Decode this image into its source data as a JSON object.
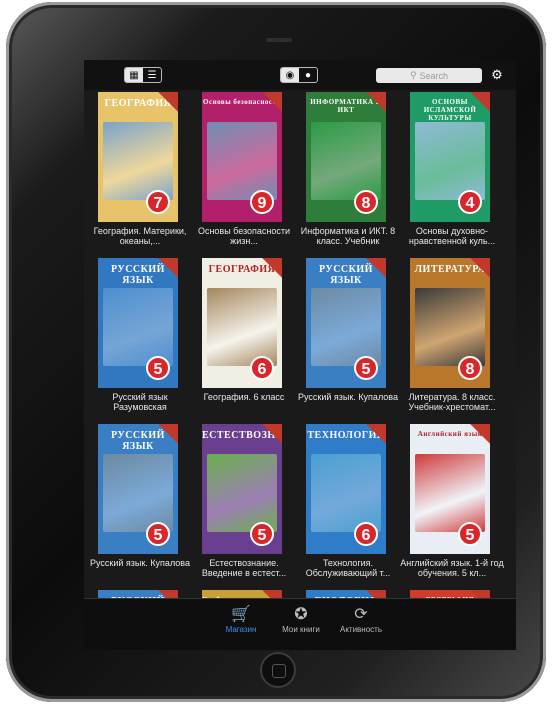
{
  "toolbar": {
    "view_grid_icon": "grid-icon",
    "view_list_icon": "list-icon",
    "globe_icon": "globe-icon",
    "person_icon": "person-icon",
    "search_placeholder": "Search",
    "settings_icon": "gear-icon"
  },
  "books": [
    {
      "cover_title": "ГЕОГРАФИЯ",
      "title": "География. Материки, океаны,...",
      "num": "7",
      "color": "#e7c46a",
      "art": "#7aa3c9"
    },
    {
      "cover_title": "Основы безопасности",
      "title": "Основы безопасности жизн...",
      "num": "9",
      "color": "#b21f6a",
      "art": "#6f8fb5"
    },
    {
      "cover_title": "ИНФОРМАТИКА И ИКТ",
      "title": "Информатика и ИКТ. 8 класс. Учебник",
      "num": "8",
      "color": "#2f7d3a",
      "art": "#2b9c45"
    },
    {
      "cover_title": "ОСНОВЫ ИСЛАМСКОЙ КУЛЬТУРЫ",
      "title": "Основы духовно-нравственной куль...",
      "num": "4",
      "color": "#1f9b66",
      "art": "#8fb9d8"
    },
    {
      "cover_title": "РУССКИЙ ЯЗЫК",
      "title": "Русский язык Разумовская",
      "num": "5",
      "color": "#3178c1",
      "art": "#4e8fcf"
    },
    {
      "cover_title": "ГЕОГРАФИЯ",
      "title": "География. 6 класс",
      "num": "6",
      "color": "#f1eee4",
      "art": "#a3865c"
    },
    {
      "cover_title": "РУССКИЙ ЯЗЫК",
      "title": "Русский язык. Купалова",
      "num": "5",
      "color": "#3a7fc4",
      "art": "#6c8aa3"
    },
    {
      "cover_title": "ЛИТЕРАТУРА",
      "title": "Литература. 8 класс. Учебник-хрестомат...",
      "num": "8",
      "color": "#b8772a",
      "art": "#3a3a3a"
    },
    {
      "cover_title": "РУССКИЙ ЯЗЫК",
      "title": "Русский язык. Купалова",
      "num": "5",
      "color": "#3a7fc4",
      "art": "#6c8aa3"
    },
    {
      "cover_title": "ЕСТЕСТВОЗНАНИЕ",
      "title": "Естествознание. Введение в естест...",
      "num": "5",
      "color": "#6b3f8f",
      "art": "#6ab04c"
    },
    {
      "cover_title": "ТЕХНОЛОГИЯ",
      "title": "Технология. Обслуживающий т...",
      "num": "6",
      "color": "#2f7dc9",
      "art": "#4aa0d0"
    },
    {
      "cover_title": "Английский язык",
      "title": "Английский язык. 1-й год обучения. 5 кл...",
      "num": "5",
      "color": "#e9eef5",
      "art": "#cf3a3a"
    },
    {
      "cover_title": "РУССКИЙ ЯЗЫК",
      "title": "",
      "num": "",
      "color": "#3a7fc4",
      "art": "#6c8aa3"
    },
    {
      "cover_title": "Учебник-хрестоматия",
      "title": "",
      "num": "",
      "color": "#c8a03a",
      "art": "#7a3a2a"
    },
    {
      "cover_title": "БИОЛОГИЯ",
      "title": "",
      "num": "",
      "color": "#2f7dc9",
      "art": "#4aa0d0"
    },
    {
      "cover_title": "ГЕОГРАФИЯ РОССИИ",
      "title": "",
      "num": "",
      "color": "#d23a2a",
      "art": "#c49a2a"
    }
  ],
  "tabs": [
    {
      "label": "Магазин",
      "icon": "cart-icon",
      "active": true
    },
    {
      "label": "Мои книги",
      "icon": "books-icon",
      "active": false
    },
    {
      "label": "Активность",
      "icon": "sync-icon",
      "active": false
    }
  ]
}
